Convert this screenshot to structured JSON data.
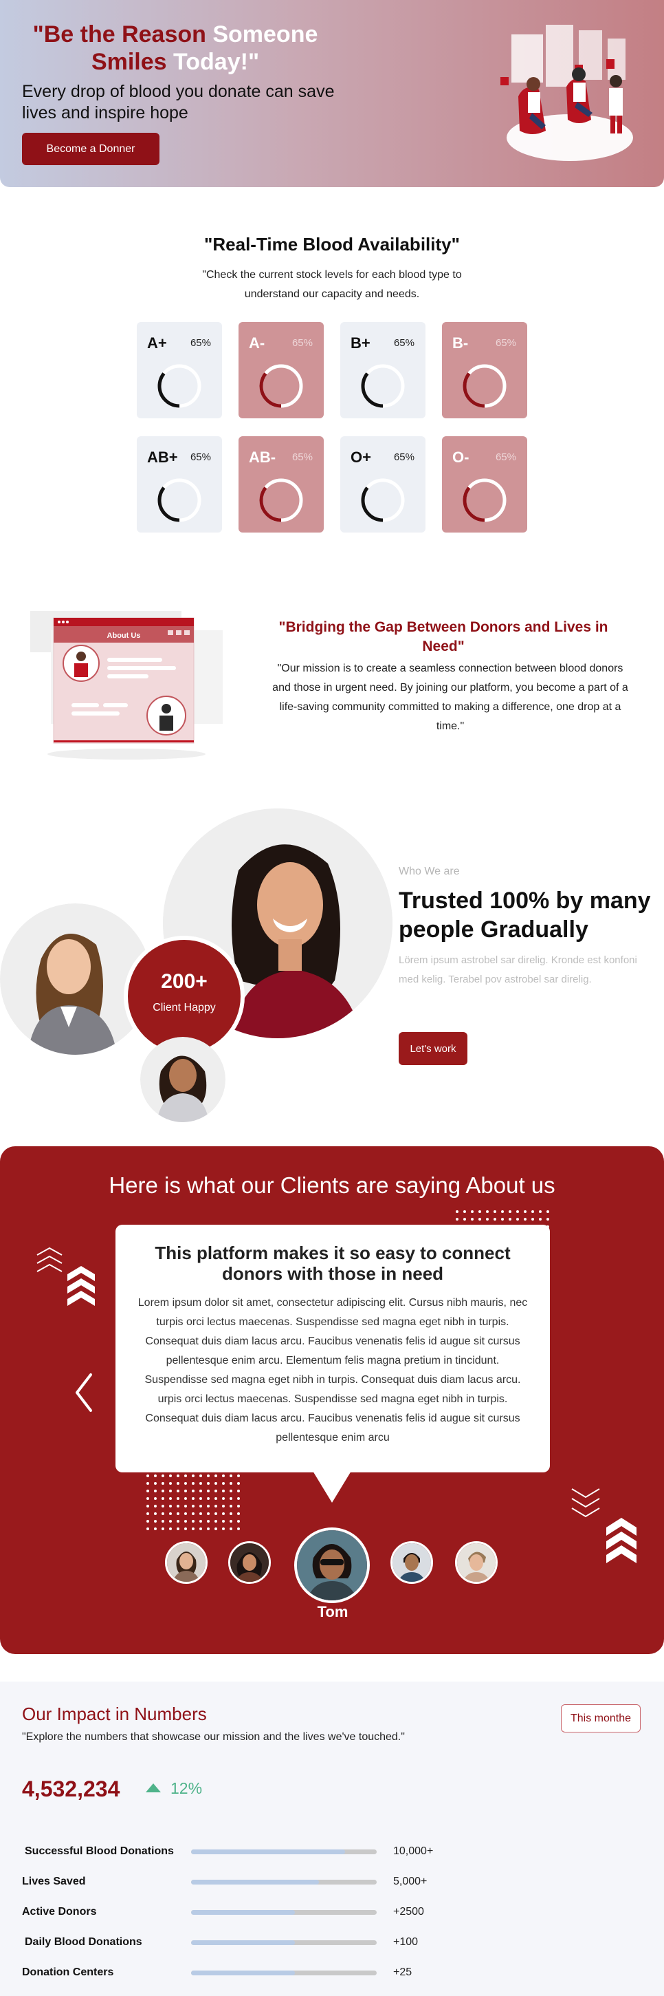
{
  "hero": {
    "title_part1": "\"Be the Reason",
    "title_part2": "Someone",
    "title_part3": "Smiles",
    "title_part4": "Today!\"",
    "subtitle": "Every drop of blood you donate can save lives and inspire hope",
    "cta_label": "Become a Donner"
  },
  "availability": {
    "title": "\"Real-Time Blood Availability\"",
    "description": "\"Check the current stock levels for each blood type to understand our capacity and needs.",
    "cards": [
      {
        "type": "A+",
        "percent": "65%",
        "level": 0.65,
        "style": "light"
      },
      {
        "type": "A-",
        "percent": "65%",
        "level": 0.65,
        "style": "red"
      },
      {
        "type": "B+",
        "percent": "65%",
        "level": 0.65,
        "style": "light"
      },
      {
        "type": "B-",
        "percent": "65%",
        "level": 0.65,
        "style": "red"
      },
      {
        "type": "AB+",
        "percent": "65%",
        "level": 0.65,
        "style": "light"
      },
      {
        "type": "AB-",
        "percent": "65%",
        "level": 0.65,
        "style": "red"
      },
      {
        "type": "O+",
        "percent": "65%",
        "level": 0.65,
        "style": "light"
      },
      {
        "type": "O-",
        "percent": "65%",
        "level": 0.65,
        "style": "red"
      }
    ]
  },
  "bridge": {
    "illustration_label": "About Us",
    "title": "\"Bridging the Gap Between Donors and Lives in Need\"",
    "description": "\"Our mission is to create a seamless connection between blood donors and those in urgent need. By joining our platform, you become a part of a life-saving community committed to making a difference, one drop at a time.\""
  },
  "who": {
    "happy_count": "200+",
    "happy_label": "Client Happy",
    "label": "Who We are",
    "title": "Trusted 100% by many people Gradually",
    "description": "Lörem ipsum astrobel sar direlig. Kronde est konfoni med kelig. Terabel pov astrobel sar direlig.",
    "cta_label": "Let's work"
  },
  "testimonials": {
    "heading": "Here is what our Clients are saying About us",
    "quote_title": "This platform makes it so easy to connect donors with those in need",
    "quote_body": "Lorem ipsum dolor sit amet, consectetur adipiscing elit. Cursus nibh mauris, nec turpis orci lectus maecenas. Suspendisse sed magna eget nibh in turpis. Consequat duis diam lacus arcu. Faucibus venenatis felis id augue sit cursus pellentesque enim arcu. Elementum felis magna pretium in tincidunt. Suspendisse sed magna eget nibh in turpis. Consequat duis diam lacus arcu. urpis orci lectus maecenas. Suspendisse sed magna eget nibh in turpis. Consequat duis diam lacus arcu. Faucibus venenatis felis id augue sit cursus pellentesque enim arcu",
    "active_name": "Tom"
  },
  "impact": {
    "title": "Our Impact in Numbers",
    "subtitle": "\"Explore the numbers that showcase our mission and the lives we've touched.\"",
    "period_button": "This monthe",
    "total": "4,532,234",
    "growth": "12%",
    "stats": [
      {
        "label": "Successful Blood Donations",
        "value": "10,000+",
        "level": 0.83
      },
      {
        "label": "Lives Saved",
        "value": "5,000+",
        "level": 0.69
      },
      {
        "label": "Active Donors",
        "value": "+2500",
        "level": 0.56
      },
      {
        "label": "Daily Blood Donations",
        "value": "+100",
        "level": 0.56
      },
      {
        "label": "Donation Centers",
        "value": "+25",
        "level": 0.56
      }
    ]
  },
  "colors": {
    "brand": "#8f1117",
    "accent_green": "#4fb38a",
    "card_red": "#cf9497",
    "card_light": "#edf0f5"
  }
}
